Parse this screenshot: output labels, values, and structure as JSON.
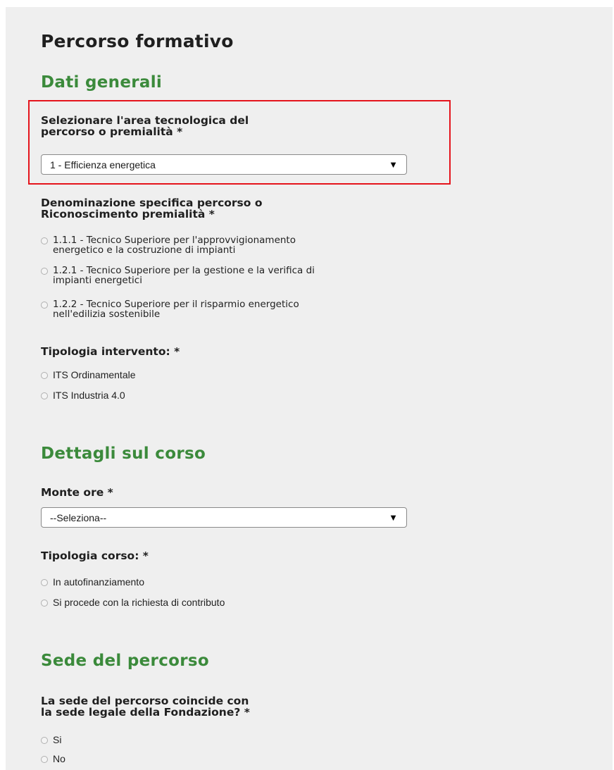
{
  "page_title": "Percorso formativo",
  "sections": {
    "dati_generali": {
      "title": "Dati generali",
      "area_label": "Selezionare l'area tecnologica del\npercorso o premialità *",
      "area_select_value": "1 - Efficienza energetica",
      "denominazione_label": "Denominazione specifica percorso o\nRiconoscimento premialità *",
      "denominazione_options": [
        "1.1.1 - Tecnico Superiore per l'approvvigionamento\nenergetico e la costruzione di impianti",
        "1.2.1 - Tecnico Superiore per la gestione e la verifica di\nimpianti energetici",
        "1.2.2 - Tecnico Superiore per il risparmio energetico\nnell'edilizia sostenibile"
      ],
      "tipologia_intervento_label": "Tipologia intervento: *",
      "tipologia_intervento_options": [
        "ITS Ordinamentale",
        "ITS Industria 4.0"
      ]
    },
    "dettagli_corso": {
      "title": "Dettagli sul corso",
      "monte_ore_label": "Monte ore *",
      "monte_ore_select_value": "--Seleziona--",
      "tipologia_corso_label": "Tipologia corso: *",
      "tipologia_corso_options": [
        "In autofinanziamento",
        "Si procede con la richiesta di contributo"
      ]
    },
    "sede_percorso": {
      "title": "Sede del percorso",
      "sede_label": "La sede del percorso coincide con\nla sede legale della Fondazione? *",
      "sede_options": [
        "Si",
        "No"
      ]
    }
  },
  "select_arrow_icon": "triangle-down-icon",
  "colors": {
    "section_title": "#3b8a3b",
    "highlight_border": "#e5141c",
    "panel_background": "#efefef"
  }
}
